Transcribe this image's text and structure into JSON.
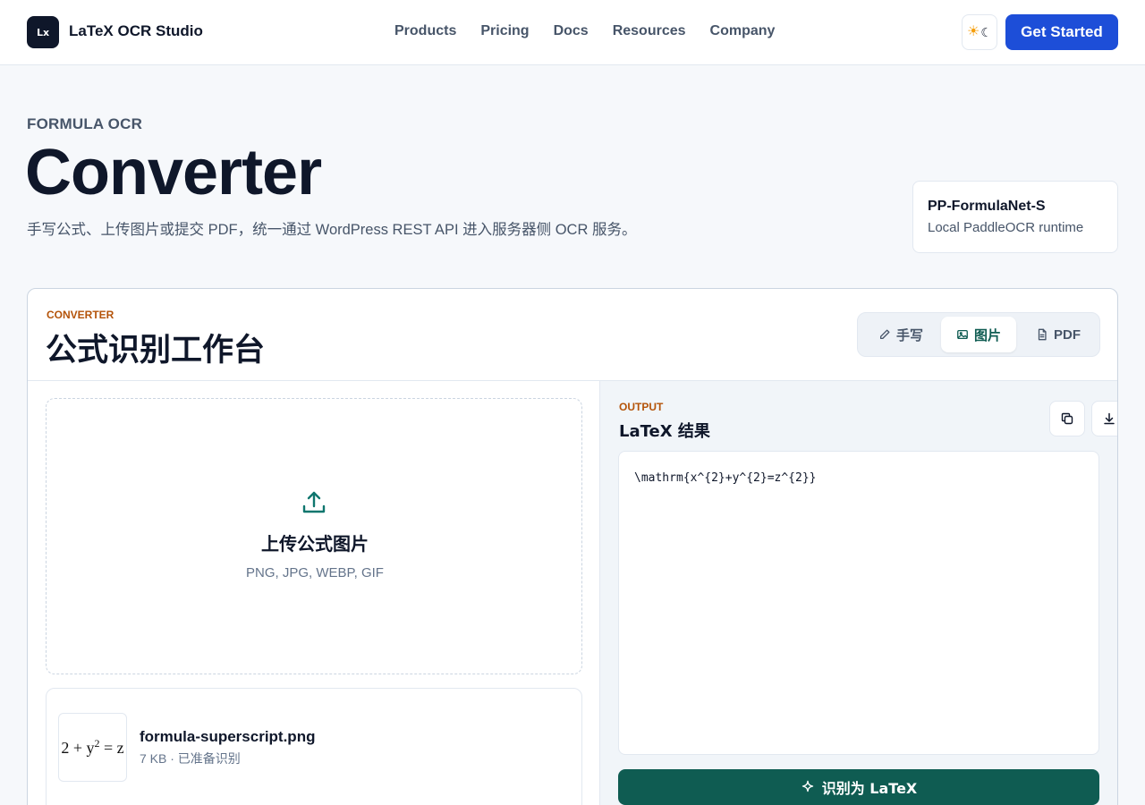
{
  "nav": {
    "logo_text": "Lx",
    "brand": "LaTeX OCR Studio",
    "links": [
      "Products",
      "Pricing",
      "Docs",
      "Resources",
      "Company"
    ],
    "cta_label": "Get Started",
    "theme_icon": "sun-moon-icon"
  },
  "hero": {
    "eyebrow": "FORMULA OCR",
    "title": "Converter",
    "subtitle": "手写公式、上传图片或提交 PDF，统一通过 WordPress REST API 进入服务器侧 OCR 服务。"
  },
  "model": {
    "name": "PP-FormulaNet-S",
    "runtime": "Local PaddleOCR runtime"
  },
  "converter": {
    "eyebrow": "CONVERTER",
    "title": "公式识别工作台",
    "tabs": [
      {
        "label": "手写",
        "icon": "pencil-icon"
      },
      {
        "label": "图片",
        "icon": "image-icon",
        "active": true
      },
      {
        "label": "PDF",
        "icon": "file-icon"
      }
    ],
    "upload": {
      "title": "上传公式图片",
      "formats": "PNG, JPG, WEBP, GIF"
    },
    "file": {
      "name": "formula-superscript.png",
      "meta": "7 KB · 已准备识别",
      "thumb_formula": "2 + y2 = z"
    },
    "output": {
      "eyebrow": "OUTPUT",
      "title": "LaTeX 结果",
      "latex": "\\mathrm{x^{2}+y^{2}=z^{2}}",
      "copy_icon": "copy-icon",
      "download_icon": "download-icon"
    },
    "recognize_label": "识别为 LaTeX"
  },
  "colors": {
    "brand_blue": "#1d4ed8",
    "accent_teal": "#0f5c52",
    "eyebrow_amber": "#b45309",
    "dark": "#0f172a"
  }
}
